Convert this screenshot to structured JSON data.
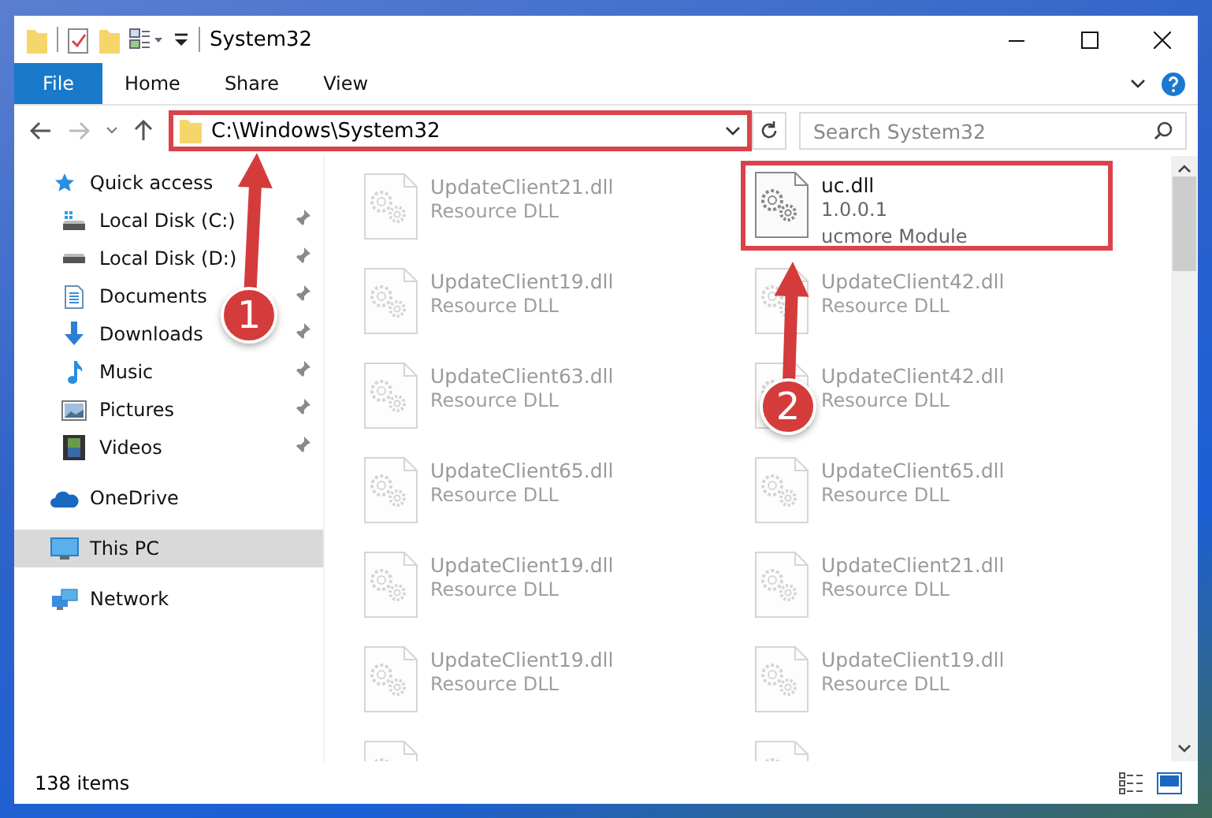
{
  "window": {
    "title": "System32"
  },
  "ribbon": {
    "tabs": [
      {
        "label": "File",
        "kind": "file"
      },
      {
        "label": "Home",
        "kind": "tab"
      },
      {
        "label": "Share",
        "kind": "tab"
      },
      {
        "label": "View",
        "kind": "tab"
      }
    ]
  },
  "address": {
    "path": "C:\\Windows\\System32",
    "highlighted": true
  },
  "search": {
    "placeholder": "Search System32"
  },
  "nav": [
    {
      "label": "Quick access",
      "kind": "star",
      "selected": false,
      "children": [
        {
          "label": "Local Disk (C:)",
          "kind": "sysdisk",
          "pinned": true,
          "selected": false
        },
        {
          "label": "Local Disk (D:)",
          "kind": "disk",
          "pinned": true,
          "selected": false
        },
        {
          "label": "Documents",
          "kind": "docs",
          "pinned": true,
          "selected": false
        },
        {
          "label": "Downloads",
          "kind": "down",
          "pinned": true,
          "selected": false
        },
        {
          "label": "Music",
          "kind": "music",
          "pinned": true,
          "selected": false
        },
        {
          "label": "Pictures",
          "kind": "pics",
          "pinned": true,
          "selected": false
        },
        {
          "label": "Videos",
          "kind": "video",
          "pinned": true,
          "selected": false
        }
      ]
    },
    {
      "label": "OneDrive",
      "kind": "cloud",
      "selected": false
    },
    {
      "label": "This PC",
      "kind": "pc",
      "selected": true
    },
    {
      "label": "Network",
      "kind": "net",
      "selected": false
    }
  ],
  "files": [
    {
      "name": "UpdateClient21.dll",
      "details": [
        "Resource DLL"
      ],
      "faded": true,
      "highlighted": false
    },
    {
      "name": "uc.dll",
      "details": [
        "1.0.0.1",
        "ucmore Module"
      ],
      "faded": false,
      "highlighted": true
    },
    {
      "name": "UpdateClient19.dll",
      "details": [
        "Resource DLL"
      ],
      "faded": true,
      "highlighted": false
    },
    {
      "name": "UpdateClient42.dll",
      "details": [
        "Resource DLL"
      ],
      "faded": true,
      "highlighted": false
    },
    {
      "name": "UpdateClient63.dll",
      "details": [
        "Resource DLL"
      ],
      "faded": true,
      "highlighted": false
    },
    {
      "name": "UpdateClient42.dll",
      "details": [
        "Resource DLL"
      ],
      "faded": true,
      "highlighted": false
    },
    {
      "name": "UpdateClient65.dll",
      "details": [
        "Resource DLL"
      ],
      "faded": true,
      "highlighted": false
    },
    {
      "name": "UpdateClient65.dll",
      "details": [
        "Resource DLL"
      ],
      "faded": true,
      "highlighted": false
    },
    {
      "name": "UpdateClient19.dll",
      "details": [
        "Resource DLL"
      ],
      "faded": true,
      "highlighted": false
    },
    {
      "name": "UpdateClient21.dll",
      "details": [
        "Resource DLL"
      ],
      "faded": true,
      "highlighted": false
    },
    {
      "name": "UpdateClient19.dll",
      "details": [
        "Resource DLL"
      ],
      "faded": true,
      "highlighted": false
    },
    {
      "name": "UpdateClient19.dll",
      "details": [
        "Resource DLL"
      ],
      "faded": true,
      "highlighted": false
    }
  ],
  "callouts": [
    {
      "number": "1"
    },
    {
      "number": "2"
    }
  ],
  "status_bar": {
    "count": "138 items"
  }
}
